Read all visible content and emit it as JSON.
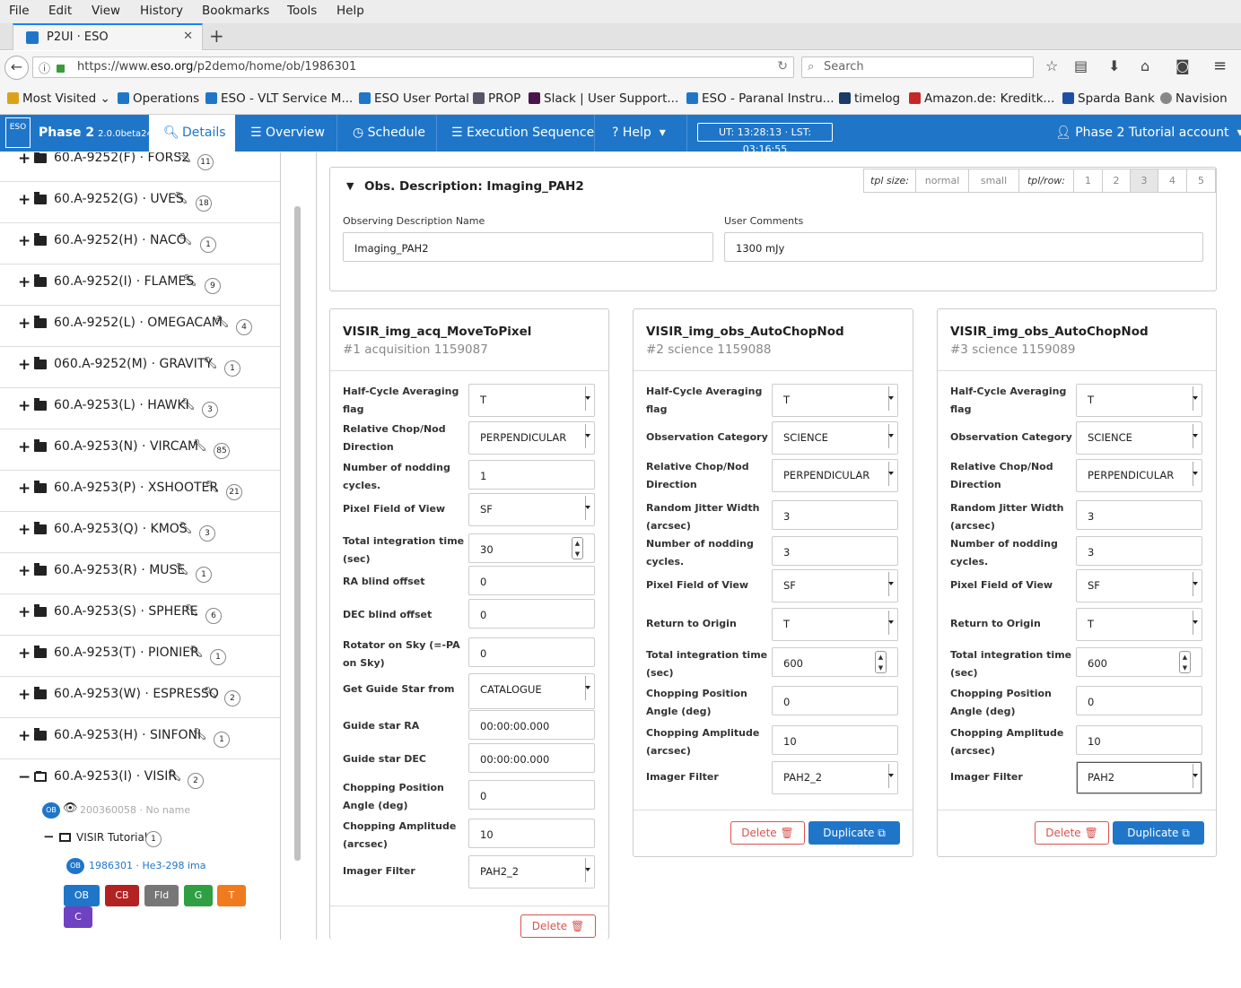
{
  "menu": [
    "File",
    "Edit",
    "View",
    "History",
    "Bookmarks",
    "Tools",
    "Help"
  ],
  "browser_tab": {
    "title": "P2UI · ESO"
  },
  "url": {
    "prefix": "https://www.",
    "domain": "eso.org",
    "path": "/p2demo/home/ob/1986301"
  },
  "search": {
    "placeholder": "Search"
  },
  "bookmarks": [
    "Most Visited",
    "Operations",
    "ESO - VLT Service M...",
    "ESO User Portal",
    "PROP",
    "Slack | User Support...",
    "ESO - Paranal Instru...",
    "timelog",
    "Amazon.de: Kreditk...",
    "Sparda Bank",
    "Navision"
  ],
  "app": {
    "logo": "ESO",
    "title": "Phase 2",
    "version": "2.0.0beta24",
    "nav": [
      "Details",
      "Overview",
      "Schedule",
      "Execution Sequence",
      "Help"
    ],
    "clock": "UT: 13:28:13 · LST: 03:16:55",
    "account": "Phase 2 Tutorial account"
  },
  "sidebar": {
    "runs": [
      {
        "label": "60.A-9252(F) · FORS2",
        "count": "11"
      },
      {
        "label": "60.A-9252(G) · UVES",
        "count": "18"
      },
      {
        "label": "60.A-9252(H) · NACO",
        "count": "1"
      },
      {
        "label": "60.A-9252(I) · FLAMES",
        "count": "9"
      },
      {
        "label": "60.A-9252(L) · OMEGACAM",
        "count": "4"
      },
      {
        "label": "060.A-9252(M) · GRAVITY",
        "count": "1"
      },
      {
        "label": "60.A-9253(L) · HAWKI",
        "count": "3"
      },
      {
        "label": "60.A-9253(N) · VIRCAM",
        "count": "85"
      },
      {
        "label": "60.A-9253(P) · XSHOOTER",
        "count": "21"
      },
      {
        "label": "60.A-9253(Q) · KMOS",
        "count": "3"
      },
      {
        "label": "60.A-9253(R) · MUSE",
        "count": "1"
      },
      {
        "label": "60.A-9253(S) · SPHERE",
        "count": "6"
      },
      {
        "label": "60.A-9253(T) · PIONIER",
        "count": "1"
      },
      {
        "label": "60.A-9253(W) · ESPRESSO",
        "count": "2"
      },
      {
        "label": "60.A-9253(H) · SINFONI",
        "count": "1"
      }
    ],
    "open_run": {
      "label": "60.A-9253(I) · VISIR",
      "count": "2"
    },
    "ob1": {
      "badge": "OB",
      "text": "200360058 · No name"
    },
    "folder": {
      "label": "VISIR Tutorial",
      "count": "1"
    },
    "ob2": {
      "badge": "OB",
      "text": "1986301 · He3-298 ima"
    },
    "actions": [
      "OB",
      "CB",
      "Fld",
      "G",
      "T",
      "C"
    ]
  },
  "obs_desc": {
    "title": "Obs. Description: Imaging_PAH2",
    "tpl_size_label": "tpl size:",
    "sizes": [
      "normal",
      "small"
    ],
    "tpl_row_label": "tpl/row:",
    "rows": [
      "1",
      "2",
      "3",
      "4",
      "5"
    ],
    "name_label": "Observing Description Name",
    "name_value": "Imaging_PAH2",
    "comments_label": "User Comments",
    "comments_value": "1300 mJy"
  },
  "templates": [
    {
      "name": "VISIR_img_acq_MoveToPixel",
      "sub": "#1 acquisition 1159087",
      "params": [
        {
          "label": "Half-Cycle Averaging flag",
          "value": "T",
          "type": "select"
        },
        {
          "label": "Relative Chop/Nod Direction",
          "value": "PERPENDICULAR",
          "type": "select"
        },
        {
          "label": "Number of nodding cycles.",
          "value": "1",
          "type": "text"
        },
        {
          "label": "Pixel Field of View",
          "value": "SF",
          "type": "select"
        },
        {
          "label": "Total integration time (sec)",
          "value": "30",
          "type": "spin"
        },
        {
          "label": "RA blind offset",
          "value": "0",
          "type": "text"
        },
        {
          "label": "DEC blind offset",
          "value": "0",
          "type": "text"
        },
        {
          "label": "Rotator on Sky (=-PA on Sky)",
          "value": "0",
          "type": "text"
        },
        {
          "label": "Get Guide Star from",
          "value": "CATALOGUE",
          "type": "select"
        },
        {
          "label": "Guide star RA",
          "value": "00:00:00.000",
          "type": "text"
        },
        {
          "label": "Guide star DEC",
          "value": "00:00:00.000",
          "type": "text"
        },
        {
          "label": "Chopping Position Angle (deg)",
          "value": "0",
          "type": "text"
        },
        {
          "label": "Chopping Amplitude (arcsec)",
          "value": "10",
          "type": "text"
        },
        {
          "label": "Imager Filter",
          "value": "PAH2_2",
          "type": "select"
        }
      ],
      "delete": "Delete"
    },
    {
      "name": "VISIR_img_obs_AutoChopNod",
      "sub": "#2 science 1159088",
      "params": [
        {
          "label": "Half-Cycle Averaging flag",
          "value": "T",
          "type": "select"
        },
        {
          "label": "Observation Category",
          "value": "SCIENCE",
          "type": "select"
        },
        {
          "label": "Relative Chop/Nod Direction",
          "value": "PERPENDICULAR",
          "type": "select"
        },
        {
          "label": "Random Jitter Width (arcsec)",
          "value": "3",
          "type": "text"
        },
        {
          "label": "Number of nodding cycles.",
          "value": "3",
          "type": "text"
        },
        {
          "label": "Pixel Field of View",
          "value": "SF",
          "type": "select"
        },
        {
          "label": "Return to Origin",
          "value": "T",
          "type": "select"
        },
        {
          "label": "Total integration time (sec)",
          "value": "600",
          "type": "spin"
        },
        {
          "label": "Chopping Position Angle (deg)",
          "value": "0",
          "type": "text"
        },
        {
          "label": "Chopping Amplitude (arcsec)",
          "value": "10",
          "type": "text"
        },
        {
          "label": "Imager Filter",
          "value": "PAH2_2",
          "type": "select"
        }
      ],
      "delete": "Delete",
      "duplicate": "Duplicate"
    },
    {
      "name": "VISIR_img_obs_AutoChopNod",
      "sub": "#3 science 1159089",
      "params": [
        {
          "label": "Half-Cycle Averaging flag",
          "value": "T",
          "type": "select"
        },
        {
          "label": "Observation Category",
          "value": "SCIENCE",
          "type": "select"
        },
        {
          "label": "Relative Chop/Nod Direction",
          "value": "PERPENDICULAR",
          "type": "select"
        },
        {
          "label": "Random Jitter Width (arcsec)",
          "value": "3",
          "type": "text"
        },
        {
          "label": "Number of nodding cycles.",
          "value": "3",
          "type": "text"
        },
        {
          "label": "Pixel Field of View",
          "value": "SF",
          "type": "select"
        },
        {
          "label": "Return to Origin",
          "value": "T",
          "type": "select"
        },
        {
          "label": "Total integration time (sec)",
          "value": "600",
          "type": "spin"
        },
        {
          "label": "Chopping Position Angle (deg)",
          "value": "0",
          "type": "text"
        },
        {
          "label": "Chopping Amplitude (arcsec)",
          "value": "10",
          "type": "text"
        },
        {
          "label": "Imager Filter",
          "value": "PAH2",
          "type": "select"
        }
      ],
      "delete": "Delete",
      "duplicate": "Duplicate"
    }
  ]
}
